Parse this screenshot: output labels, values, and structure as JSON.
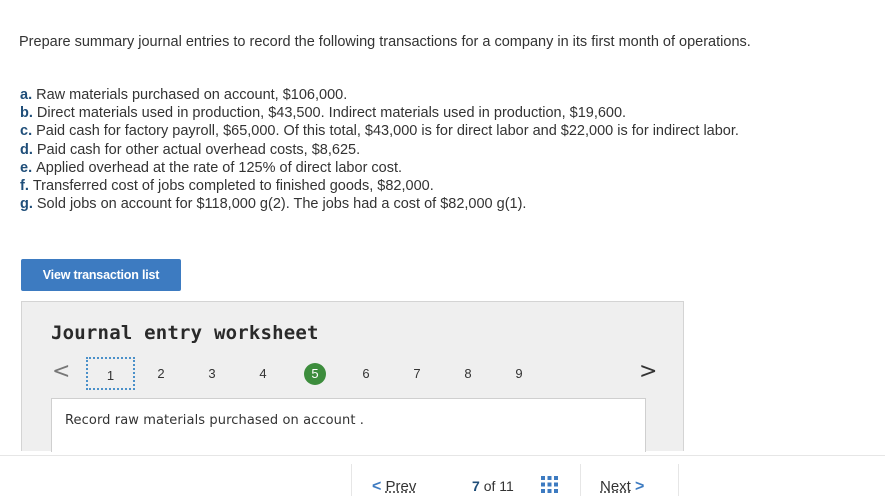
{
  "prompt": "Prepare summary journal entries to record the following transactions for a company in its first month of operations.",
  "transactions": [
    {
      "letter": "a.",
      "text": "Raw materials purchased on account, $106,000."
    },
    {
      "letter": "b.",
      "text": "Direct materials used in production, $43,500. Indirect materials used in production, $19,600."
    },
    {
      "letter": "c.",
      "text": "Paid cash for factory payroll, $65,000. Of this total, $43,000 is for direct labor and $22,000 is for indirect labor."
    },
    {
      "letter": "d.",
      "text": "Paid cash for other actual overhead costs, $8,625."
    },
    {
      "letter": "e.",
      "text": "Applied overhead at the rate of 125% of direct labor cost."
    },
    {
      "letter": "f.",
      "text": "Transferred cost of jobs completed to finished goods, $82,000."
    },
    {
      "letter": "g.",
      "text": "Sold jobs on account for $118,000 g(2).  The jobs had a cost of $82,000 g(1)."
    }
  ],
  "view_button": "View transaction list",
  "worksheet": {
    "title": "Journal entry worksheet",
    "pages": [
      "1",
      "2",
      "3",
      "4",
      "5",
      "6",
      "7",
      "8",
      "9"
    ],
    "selected_page": "1",
    "completed_page": "5",
    "left_arrow": "<",
    "right_arrow": ">",
    "instruction": "Record raw materials purchased on account ."
  },
  "footer": {
    "prev_label": "Prev",
    "next_label": "Next",
    "current": "7",
    "of": "of",
    "total": "11",
    "prev_chevron": "<",
    "next_chevron": ">",
    "grid_icon": "grid-icon"
  },
  "colors": {
    "accent": "#3d7bc1",
    "completed": "#3d8d3d"
  }
}
